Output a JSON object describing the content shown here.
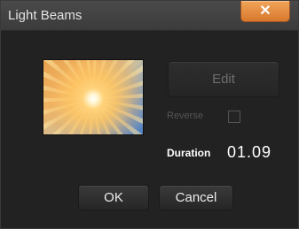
{
  "dialog": {
    "title": "Light Beams",
    "close_glyph": "✕",
    "thumbnail": {
      "description_icon": "light-beams-thumbnail"
    },
    "edit_label": "Edit",
    "reverse_label": "Reverse",
    "reverse_checked": false,
    "duration_label": "Duration",
    "duration_value": "01.09",
    "ok_label": "OK",
    "cancel_label": "Cancel"
  },
  "colors": {
    "background": "#222222",
    "titlebar": "#3b3b3b",
    "close_accent": "#e08a3a",
    "disabled_text": "#555555",
    "text": "#ffffff"
  }
}
